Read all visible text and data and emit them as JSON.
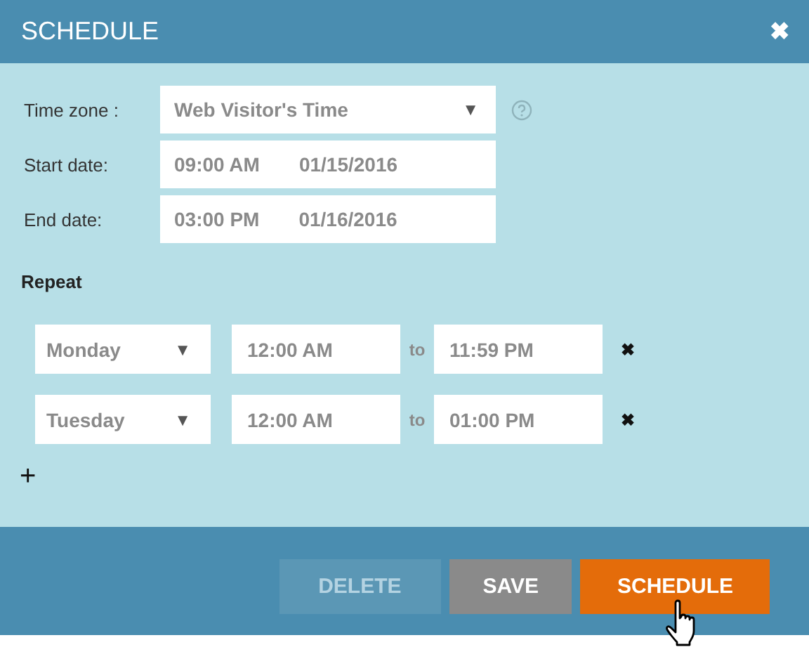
{
  "window": {
    "title": "SCHEDULE",
    "close": "✖"
  },
  "time_zone": {
    "label": "Time zone :",
    "value": "Web Visitor's Time",
    "caret": "▼"
  },
  "start_date": {
    "label": "Start date:",
    "time": "09:00 AM",
    "date": "01/15/2016"
  },
  "end_date": {
    "label": "End date:",
    "time": "03:00 PM",
    "date": "01/16/2016"
  },
  "repeat": {
    "label": "Repeat",
    "rows": [
      {
        "day": "Monday",
        "caret": "▼",
        "start": "12:00 AM",
        "to": "to",
        "end": "11:59 PM",
        "remove": "✖"
      },
      {
        "day": "Tuesday",
        "caret": "▼",
        "start": "12:00 AM",
        "to": "to",
        "end": "01:00 PM",
        "remove": "✖"
      }
    ],
    "add": "+"
  },
  "buttons": [
    {
      "label": "DELETE",
      "kind": "secondary",
      "disabled": true
    },
    {
      "label": "SAVE",
      "kind": "secondary",
      "disabled": false
    },
    {
      "label": "SCHEDULE",
      "kind": "primary",
      "disabled": false
    }
  ]
}
